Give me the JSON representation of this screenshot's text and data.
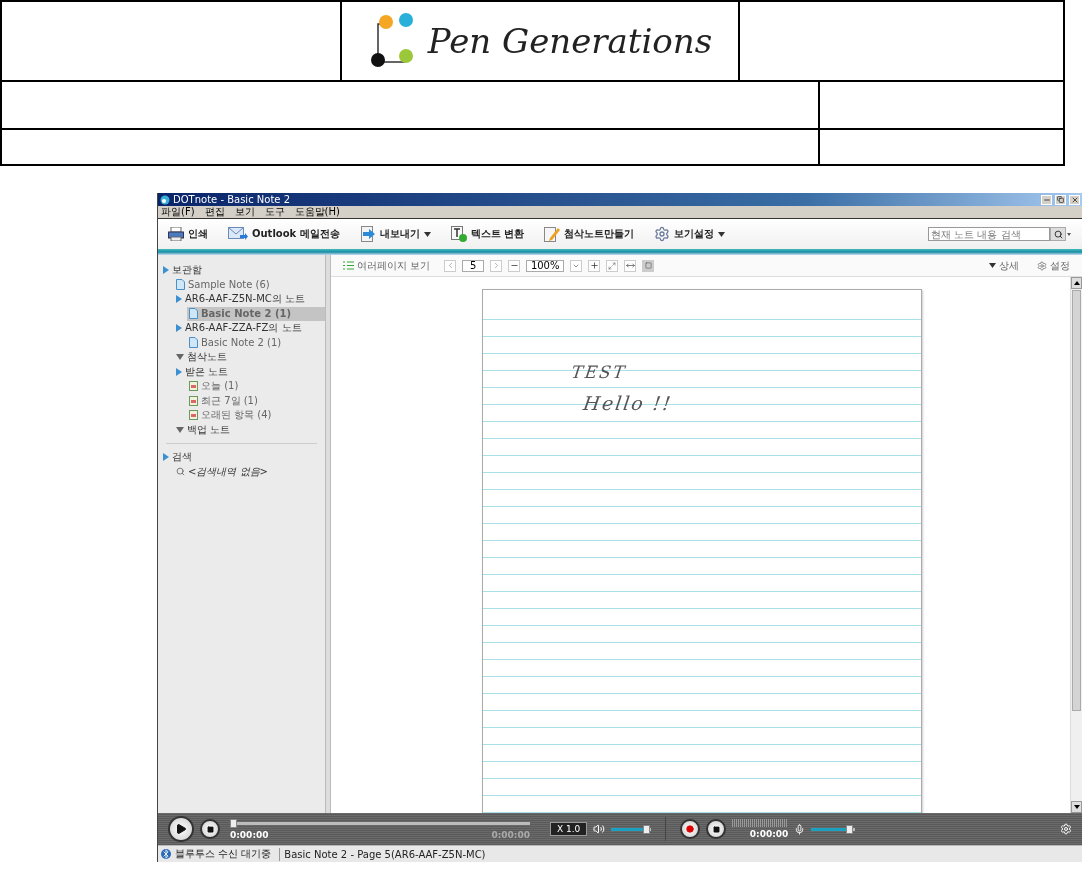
{
  "document_header": {
    "logo": "Pen Generations"
  },
  "window": {
    "title": "DOTnote - Basic Note 2"
  },
  "menu": [
    "파일(F)",
    "편집",
    "보기",
    "도구",
    "도움말(H)"
  ],
  "toolbar": [
    {
      "kind": "print",
      "label": "인쇄",
      "dropdown": false
    },
    {
      "kind": "mail",
      "label": "Outlook 메일전송",
      "dropdown": false
    },
    {
      "kind": "export",
      "label": "내보내기",
      "dropdown": true
    },
    {
      "kind": "text",
      "label": "텍스트 변환",
      "dropdown": false
    },
    {
      "kind": "edit",
      "label": "첨삭노트만들기",
      "dropdown": false
    },
    {
      "kind": "settings",
      "label": "보기설정",
      "dropdown": true
    }
  ],
  "search": {
    "placeholder": "현재 노트 내용 검색"
  },
  "sidebar": {
    "tree": [
      {
        "kind": "folder",
        "label": "보관함",
        "selected": false,
        "children": [
          {
            "kind": "note",
            "label": "Sample Note (6)",
            "selected": false
          },
          {
            "kind": "folder",
            "label": "AR6-AAF-Z5N-MC의 노트",
            "selected": false,
            "children": [
              {
                "kind": "note",
                "label": "Basic Note 2 (1)",
                "selected": true
              }
            ]
          },
          {
            "kind": "folder",
            "label": "AR6-AAF-ZZA-FZ의 노트",
            "selected": false,
            "children": [
              {
                "kind": "note",
                "label": "Basic Note 2 (1)",
                "selected": false
              }
            ]
          },
          {
            "kind": "group",
            "label": "첨삭노트",
            "selected": false
          },
          {
            "kind": "folder",
            "label": "받은 노트",
            "selected": false,
            "children": [
              {
                "kind": "date",
                "label": "오늘 (1)",
                "selected": false
              },
              {
                "kind": "date",
                "label": "최근 7일 (1)",
                "selected": false
              },
              {
                "kind": "date",
                "label": "오래된 항목 (4)",
                "selected": false
              }
            ]
          },
          {
            "kind": "group",
            "label": "백업 노트",
            "selected": false
          }
        ]
      }
    ],
    "search_tree": [
      {
        "kind": "folder",
        "label": "검색",
        "selected": false,
        "children": [
          {
            "kind": "history",
            "label": "<검색내역 없음>",
            "selected": false
          }
        ]
      }
    ]
  },
  "viewer_toolbar": {
    "multi_page": "여러페이지 보기",
    "page": "5",
    "zoom": "100%",
    "detail": "상세",
    "settings": "설정"
  },
  "note": {
    "lines": [
      "TEST",
      "Hello !!"
    ]
  },
  "player": {
    "position": {
      "level": 0
    },
    "time": "0:00:00",
    "duration": "0:00:00",
    "speed": "X 1.0",
    "volume": {
      "level": 0.88
    },
    "record_time": "0:00:00",
    "mic": {
      "level": 0.88
    }
  },
  "status_bar": {
    "connection": "블루투스 수신 대기중",
    "page": "Basic Note 2 - Page 5(AR6-AAF-Z5N-MC)"
  }
}
